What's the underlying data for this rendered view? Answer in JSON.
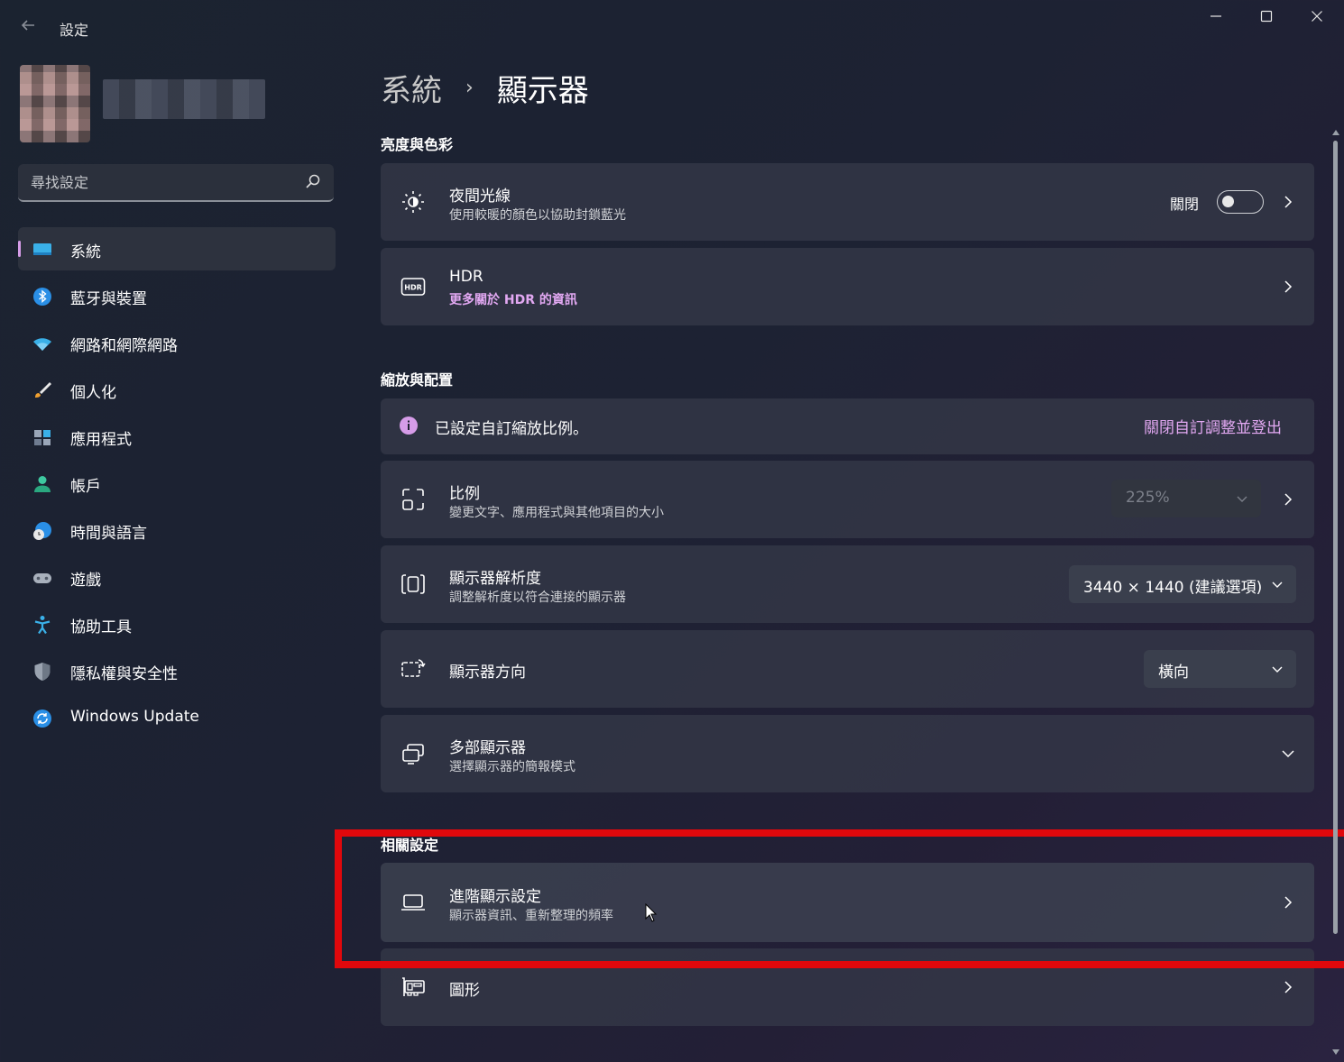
{
  "window": {
    "title": "設定",
    "controls": {
      "minimize": "—",
      "maximize": "☐",
      "close": "✕"
    }
  },
  "search": {
    "placeholder": "尋找設定"
  },
  "sidebar": {
    "items": [
      {
        "label": "系統",
        "icon": "system-icon",
        "active": true
      },
      {
        "label": "藍牙與裝置",
        "icon": "bluetooth-icon"
      },
      {
        "label": "網路和網際網路",
        "icon": "wifi-icon"
      },
      {
        "label": "個人化",
        "icon": "brush-icon"
      },
      {
        "label": "應用程式",
        "icon": "apps-icon"
      },
      {
        "label": "帳戶",
        "icon": "account-icon"
      },
      {
        "label": "時間與語言",
        "icon": "time-language-icon"
      },
      {
        "label": "遊戲",
        "icon": "gamepad-icon"
      },
      {
        "label": "協助工具",
        "icon": "accessibility-icon"
      },
      {
        "label": "隱私權與安全性",
        "icon": "shield-icon"
      },
      {
        "label": "Windows Update",
        "icon": "update-icon"
      }
    ]
  },
  "breadcrumb": {
    "parent": "系統",
    "separator": "›",
    "current": "顯示器"
  },
  "sections": {
    "brightness": {
      "title": "亮度與色彩",
      "night_light": {
        "title": "夜間光線",
        "desc": "使用較暖的顏色以協助封鎖藍光",
        "toggle_label": "關閉",
        "toggle_on": false
      },
      "hdr": {
        "title": "HDR",
        "desc": "更多關於 HDR 的資訊"
      }
    },
    "scale_layout": {
      "title": "縮放與配置",
      "info": {
        "text": "已設定自訂縮放比例。",
        "action": "關閉自訂調整並登出"
      },
      "scale": {
        "title": "比例",
        "desc": "變更文字、應用程式與其他項目的大小",
        "value": "225%"
      },
      "resolution": {
        "title": "顯示器解析度",
        "desc": "調整解析度以符合連接的顯示器",
        "value": "3440 × 1440 (建議選項)"
      },
      "orientation": {
        "title": "顯示器方向",
        "value": "橫向"
      },
      "multiple": {
        "title": "多部顯示器",
        "desc": "選擇顯示器的簡報模式"
      }
    },
    "related": {
      "title": "相關設定",
      "advanced": {
        "title": "進階顯示設定",
        "desc": "顯示器資訊、重新整理的頻率"
      },
      "graphics": {
        "title": "圖形"
      }
    }
  },
  "colors": {
    "accent": "#d69ce8",
    "link": "#e2a8f2",
    "highlight": "#e0080c"
  }
}
